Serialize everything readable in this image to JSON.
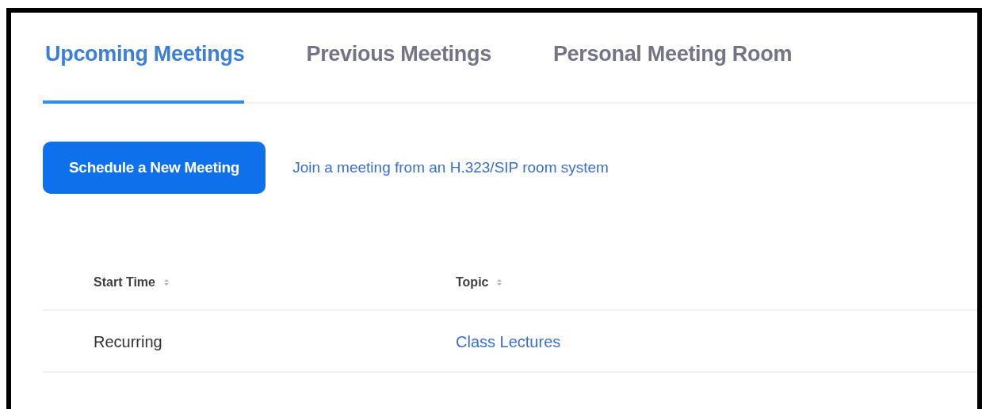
{
  "tabs": [
    {
      "label": "Upcoming Meetings",
      "selected": true
    },
    {
      "label": "Previous Meetings",
      "selected": false
    },
    {
      "label": "Personal Meeting Room",
      "selected": false
    }
  ],
  "schedule_button": {
    "label": "Schedule a New Meeting"
  },
  "join_link": {
    "label": "Join a meeting from an H.323/SIP room system"
  },
  "table": {
    "columns": [
      {
        "label": "Start Time",
        "sortable": true
      },
      {
        "label": "Topic",
        "sortable": true
      }
    ],
    "rows": [
      {
        "cells": [
          {
            "kind": "text",
            "text": "Recurring"
          },
          {
            "kind": "link",
            "text": "Class Lectures"
          }
        ]
      }
    ]
  }
}
